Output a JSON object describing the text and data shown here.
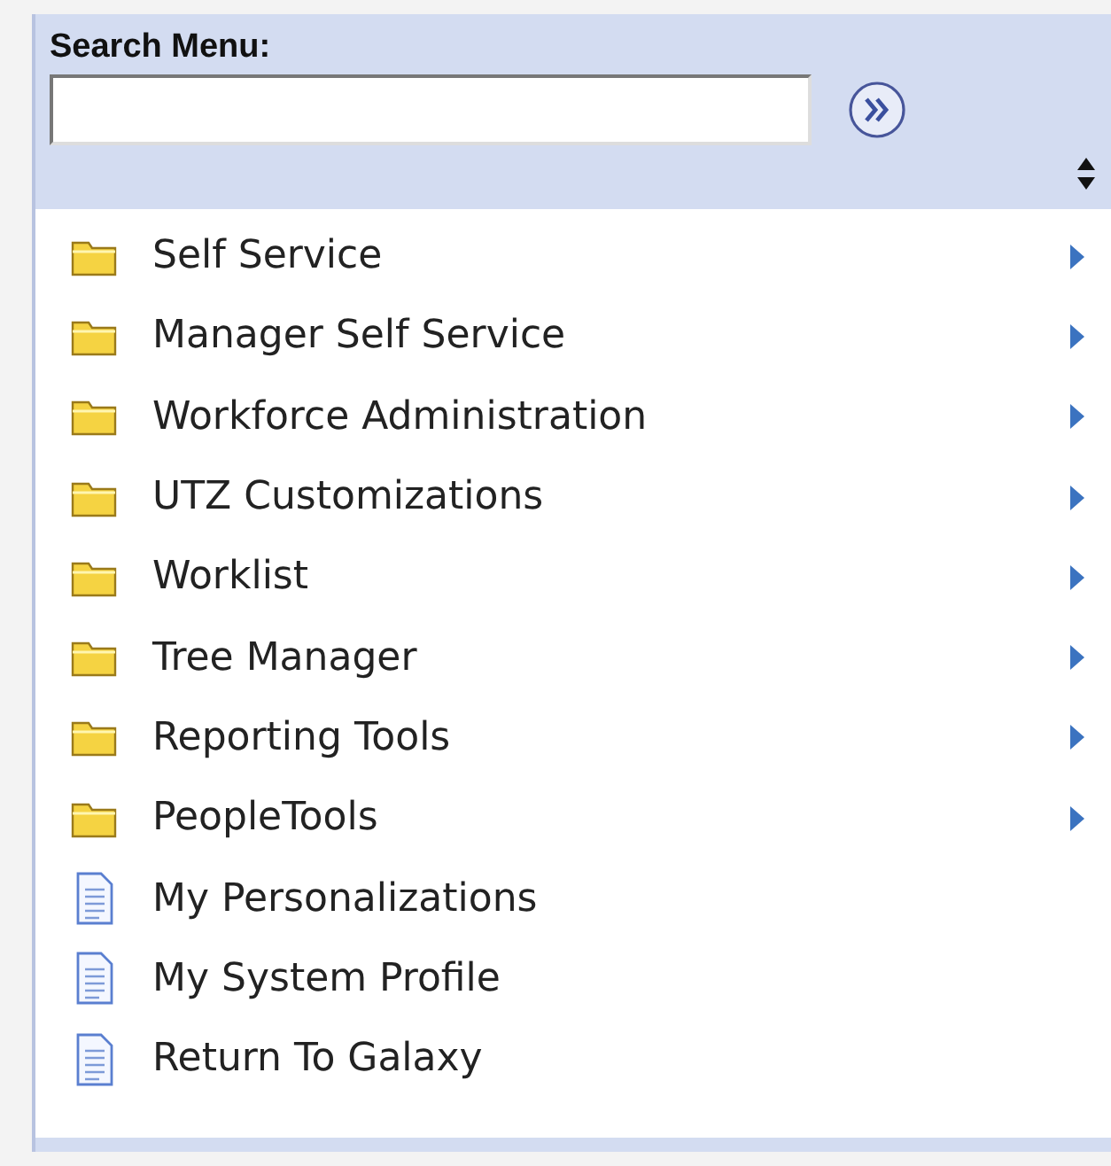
{
  "search": {
    "label": "Search Menu:"
  },
  "items": [
    {
      "kind": "folder",
      "label": "Self Service"
    },
    {
      "kind": "folder",
      "label": "Manager Self Service"
    },
    {
      "kind": "folder",
      "label": "Workforce Administration"
    },
    {
      "kind": "folder",
      "label": "UTZ Customizations"
    },
    {
      "kind": "folder",
      "label": "Worklist"
    },
    {
      "kind": "folder",
      "label": "Tree Manager"
    },
    {
      "kind": "folder",
      "label": "Reporting Tools"
    },
    {
      "kind": "folder",
      "label": "PeopleTools"
    },
    {
      "kind": "page",
      "label": "My Personalizations"
    },
    {
      "kind": "page",
      "label": "My System Profile"
    },
    {
      "kind": "page",
      "label": "Return To Galaxy"
    }
  ]
}
